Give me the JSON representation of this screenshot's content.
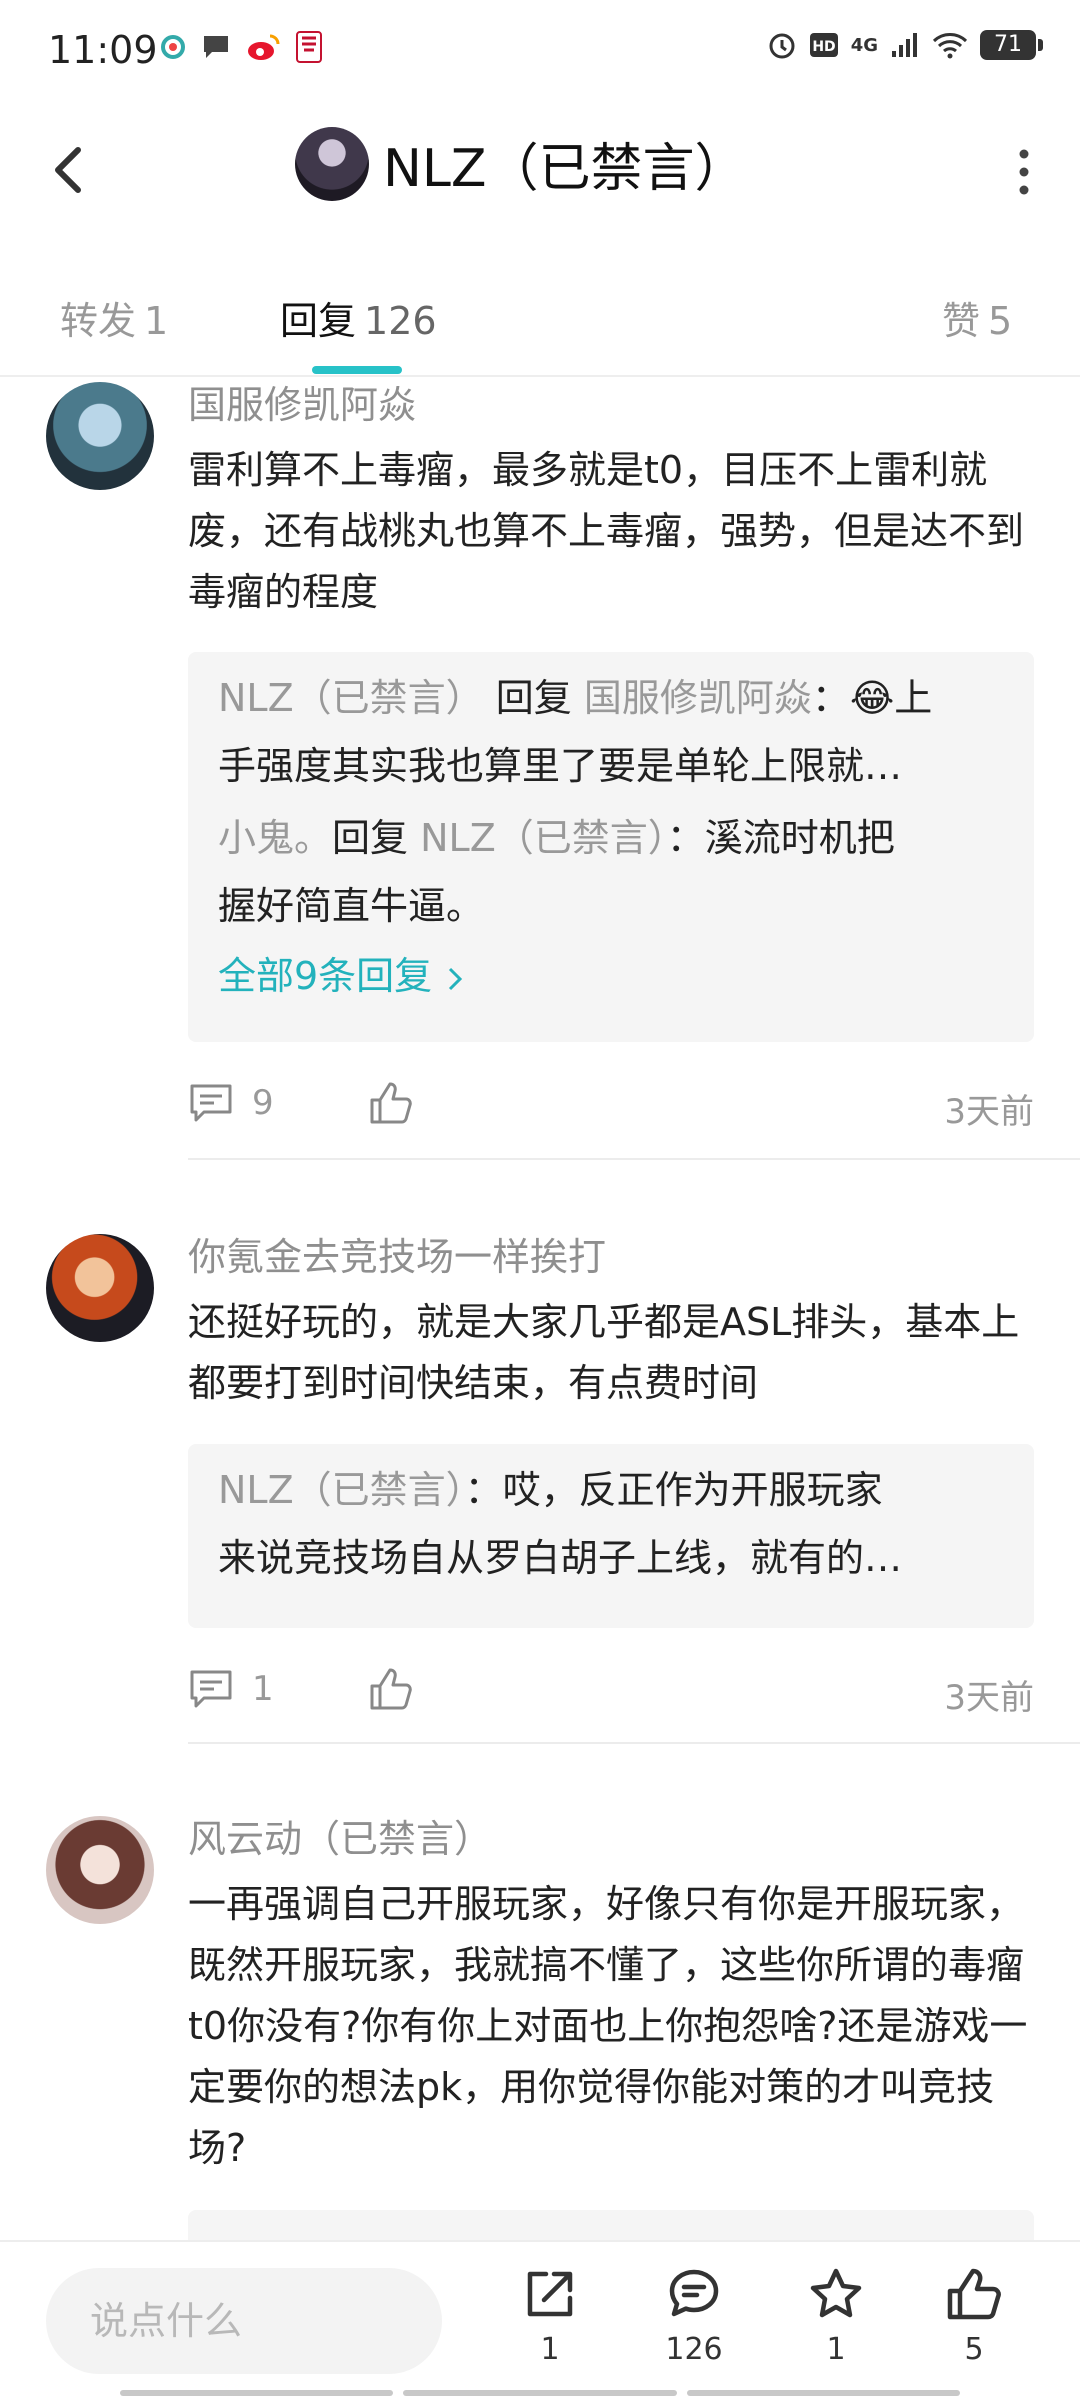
{
  "status": {
    "time": "11:09",
    "battery": "71",
    "net": "4G",
    "hd": "HD",
    "notifications": [
      "app-icon-1",
      "message-icon",
      "weibo-icon",
      "kfc-icon"
    ]
  },
  "header": {
    "title": "NLZ（已禁言）",
    "back_icon": "back-icon",
    "more_icon": "more-icon"
  },
  "tabs": [
    {
      "label": "转发",
      "count": "1"
    },
    {
      "label": "回复",
      "count": "126",
      "active": true
    },
    {
      "label": "赞",
      "count": "5"
    }
  ],
  "comments": [
    {
      "author": "国服修凯阿焱",
      "text": "雷利算不上毒瘤，最多就是t0，目压不上雷利就废，还有战桃丸也算不上毒瘤，强势，但是达不到毒瘤的程度",
      "replies": [
        {
          "from": "NLZ（已禁言）",
          "verb": "回复",
          "to": "国服修凯阿焱",
          "colon": "：",
          "emoji": "😂",
          "content_line1": "上",
          "content_line2": "手强度其实我也算里了要是单轮上限就…"
        },
        {
          "from": "小鬼。",
          "verb": "回复",
          "to": "NLZ（已禁言）",
          "colon": "：",
          "content_line1": "溪流时机把",
          "content_line2": "握好简直牛逼。"
        }
      ],
      "see_all": "全部9条回复",
      "comment_count": "9",
      "time": "3天前"
    },
    {
      "author": "你氪金去竞技场一样挨打",
      "text": "还挺好玩的，就是大家几乎都是ASL排头，基本上都要打到时间快结束，有点费时间",
      "replies": [
        {
          "from": "NLZ（已禁言）",
          "colon": "：",
          "content_line1": "哎，反正作为开服玩家",
          "content_line2": "来说竞技场自从罗白胡子上线，就有的…"
        }
      ],
      "comment_count": "1",
      "time": "3天前"
    },
    {
      "author": "风云动（已禁言）",
      "text": "一再强调自己开服玩家，好像只有你是开服玩家，既然开服玩家，我就搞不懂了，这些你所谓的毒瘤t0你没有?你有你上对面也上你抱怨啥?还是游戏一定要你的想法pk，用你觉得你能对策的才叫竞技场?"
    }
  ],
  "bottom": {
    "placeholder": "说点什么",
    "share_count": "1",
    "comment_count": "126",
    "fav_count": "1",
    "like_count": "5"
  },
  "colors": {
    "accent": "#23b2bc",
    "underline": "#27c2c8"
  }
}
